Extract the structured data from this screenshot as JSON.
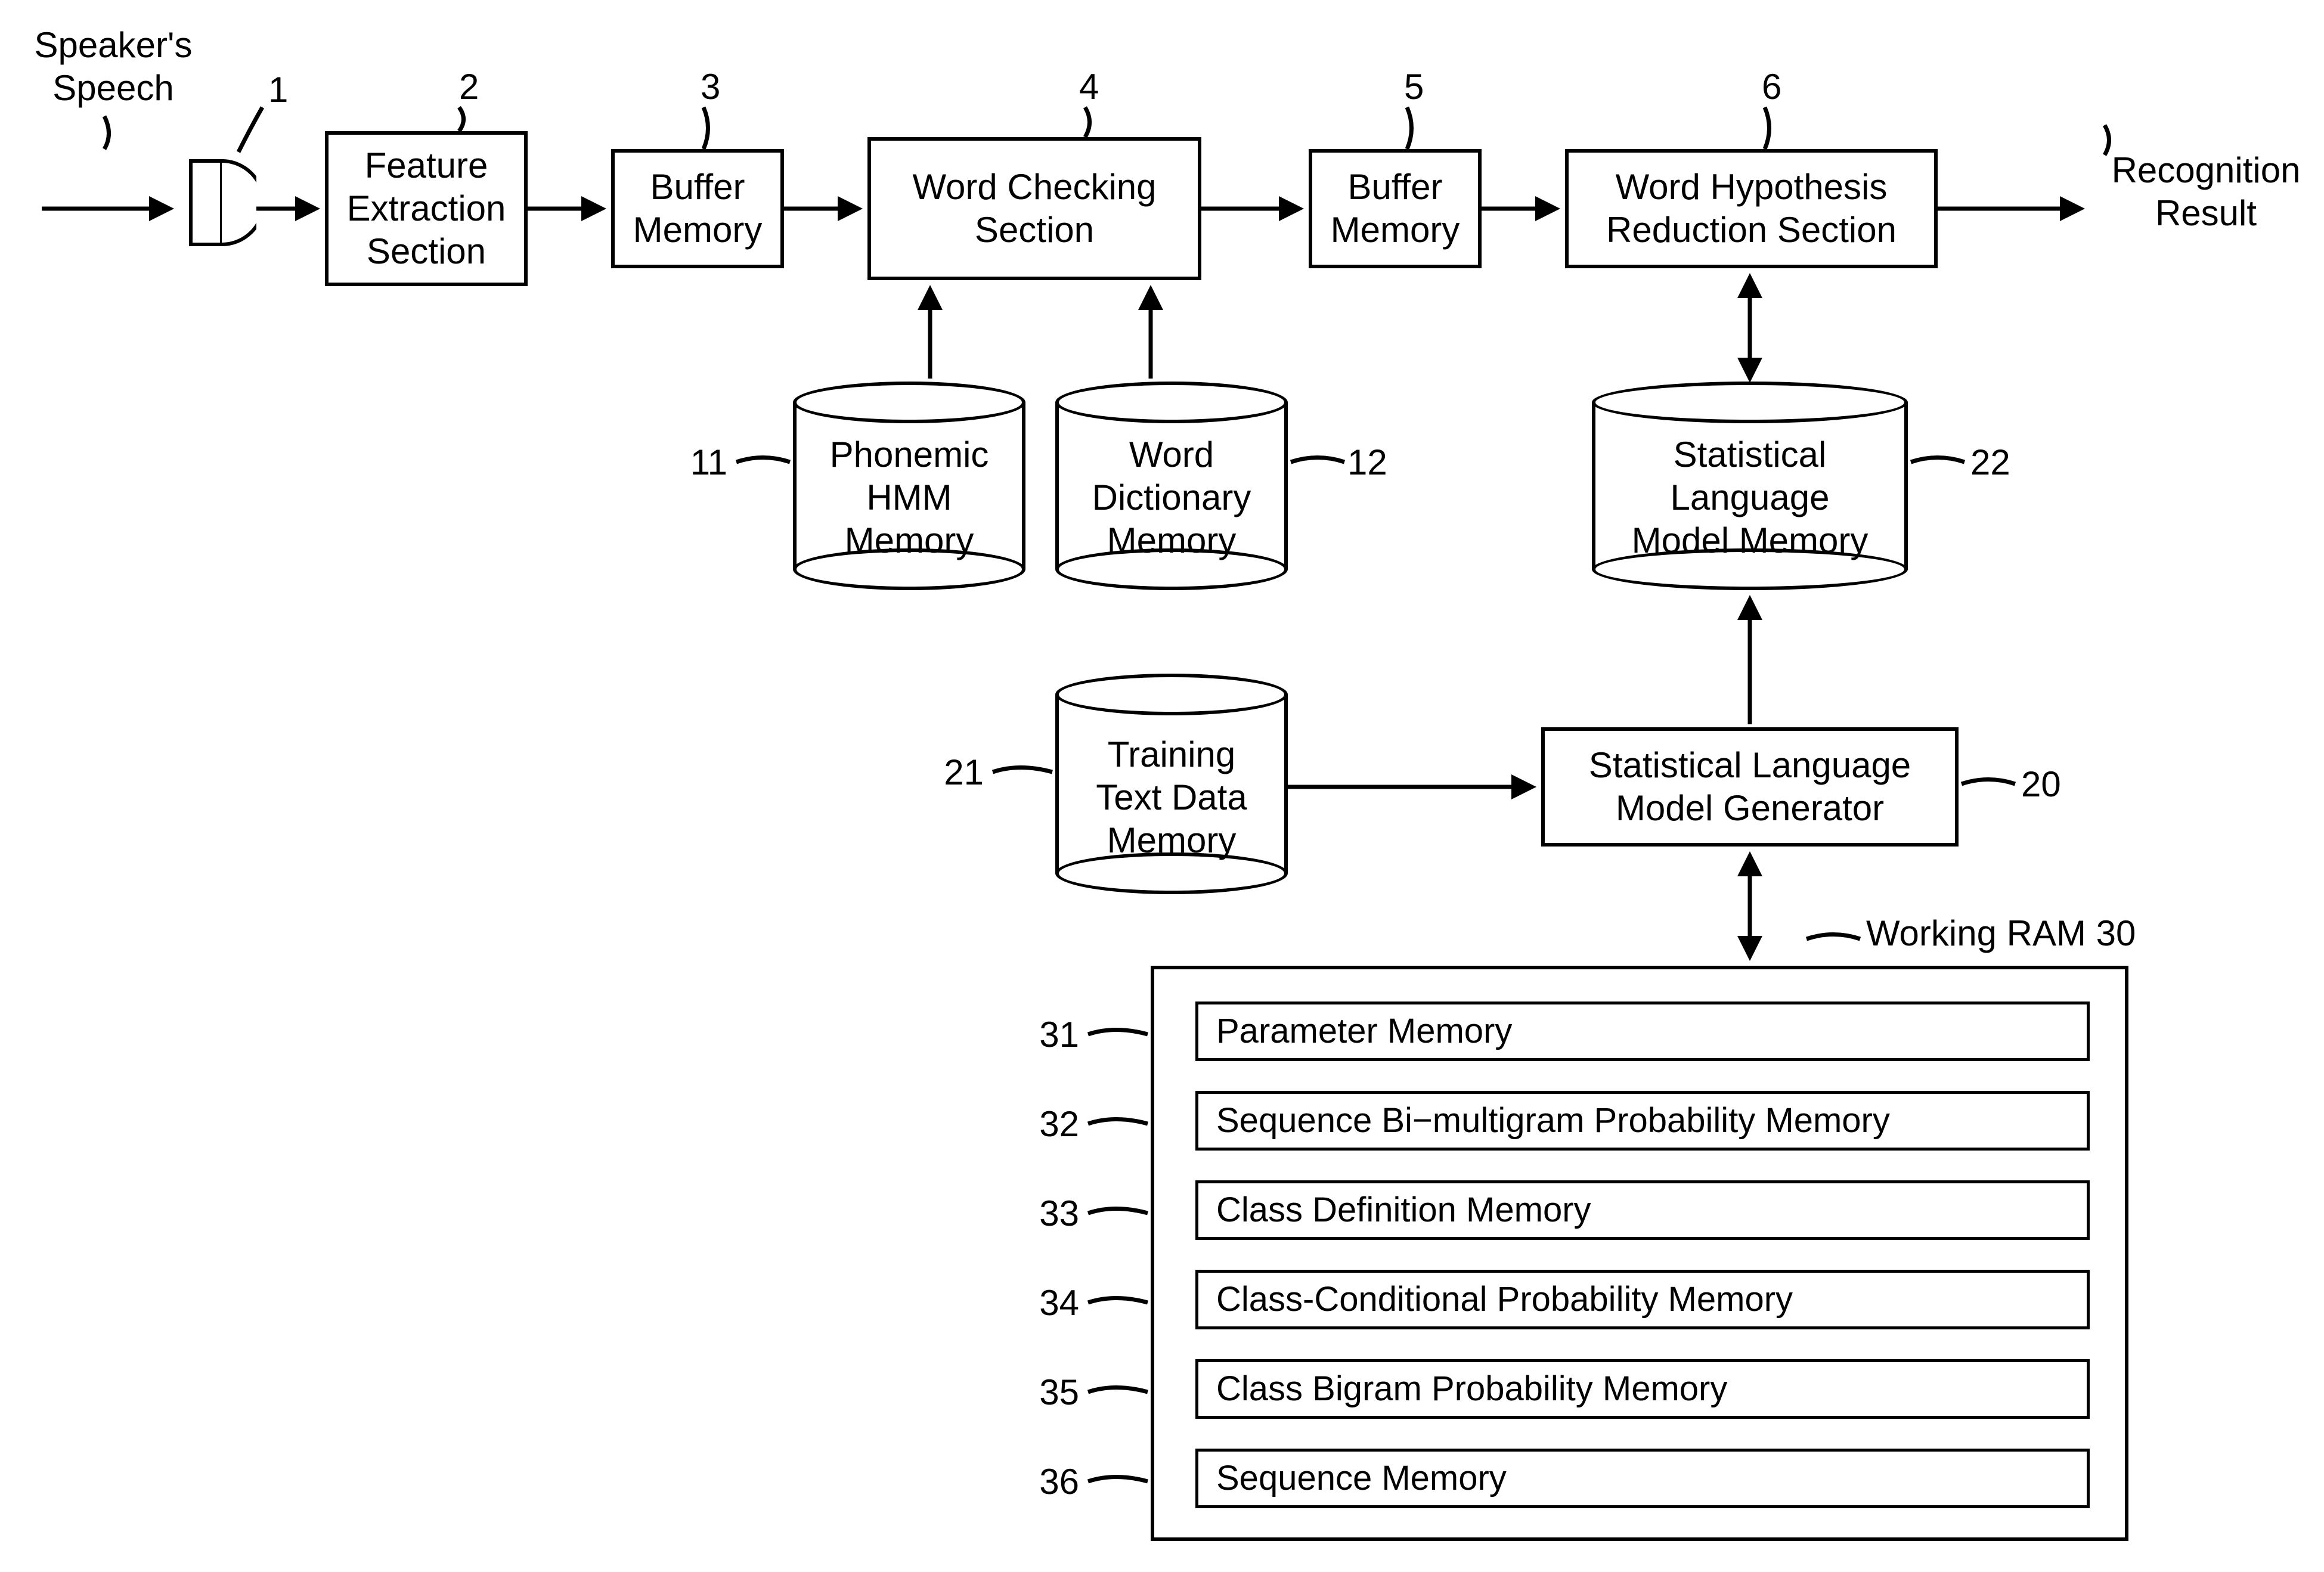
{
  "title": "Speech Recognition System Block Diagram",
  "inputLabel": "Speaker's\nSpeech",
  "outputLabel": "Recognition\nResult",
  "blocks": {
    "mic": {
      "num": "1"
    },
    "feat": {
      "num": "2",
      "text": "Feature\nExtraction\nSection"
    },
    "buf1": {
      "num": "3",
      "text": "Buffer\nMemory"
    },
    "wcs": {
      "num": "4",
      "text": "Word Checking\nSection"
    },
    "buf2": {
      "num": "5",
      "text": "Buffer\nMemory"
    },
    "whrs": {
      "num": "6",
      "text": "Word Hypothesis\nReduction Section"
    }
  },
  "cylinders": {
    "phmm": {
      "num": "11",
      "text": "Phonemic\nHMM\nMemory"
    },
    "wdict": {
      "num": "12",
      "text": "Word\nDictionary\nMemory"
    },
    "slmm": {
      "num": "22",
      "text": "Statistical\nLanguage\nModel Memory"
    },
    "ttdm": {
      "num": "21",
      "text": "Training\nText Data\nMemory"
    }
  },
  "slmg": {
    "num": "20",
    "text": "Statistical Language\nModel Generator"
  },
  "workingRam": {
    "label": "Working  RAM 30",
    "items": [
      {
        "num": "31",
        "text": "Parameter Memory"
      },
      {
        "num": "32",
        "text": "Sequence Bi−multigram Probability Memory"
      },
      {
        "num": "33",
        "text": "Class Definition Memory"
      },
      {
        "num": "34",
        "text": "Class-Conditional Probability Memory"
      },
      {
        "num": "35",
        "text": "Class Bigram Probability Memory"
      },
      {
        "num": "36",
        "text": "Sequence Memory"
      }
    ]
  }
}
